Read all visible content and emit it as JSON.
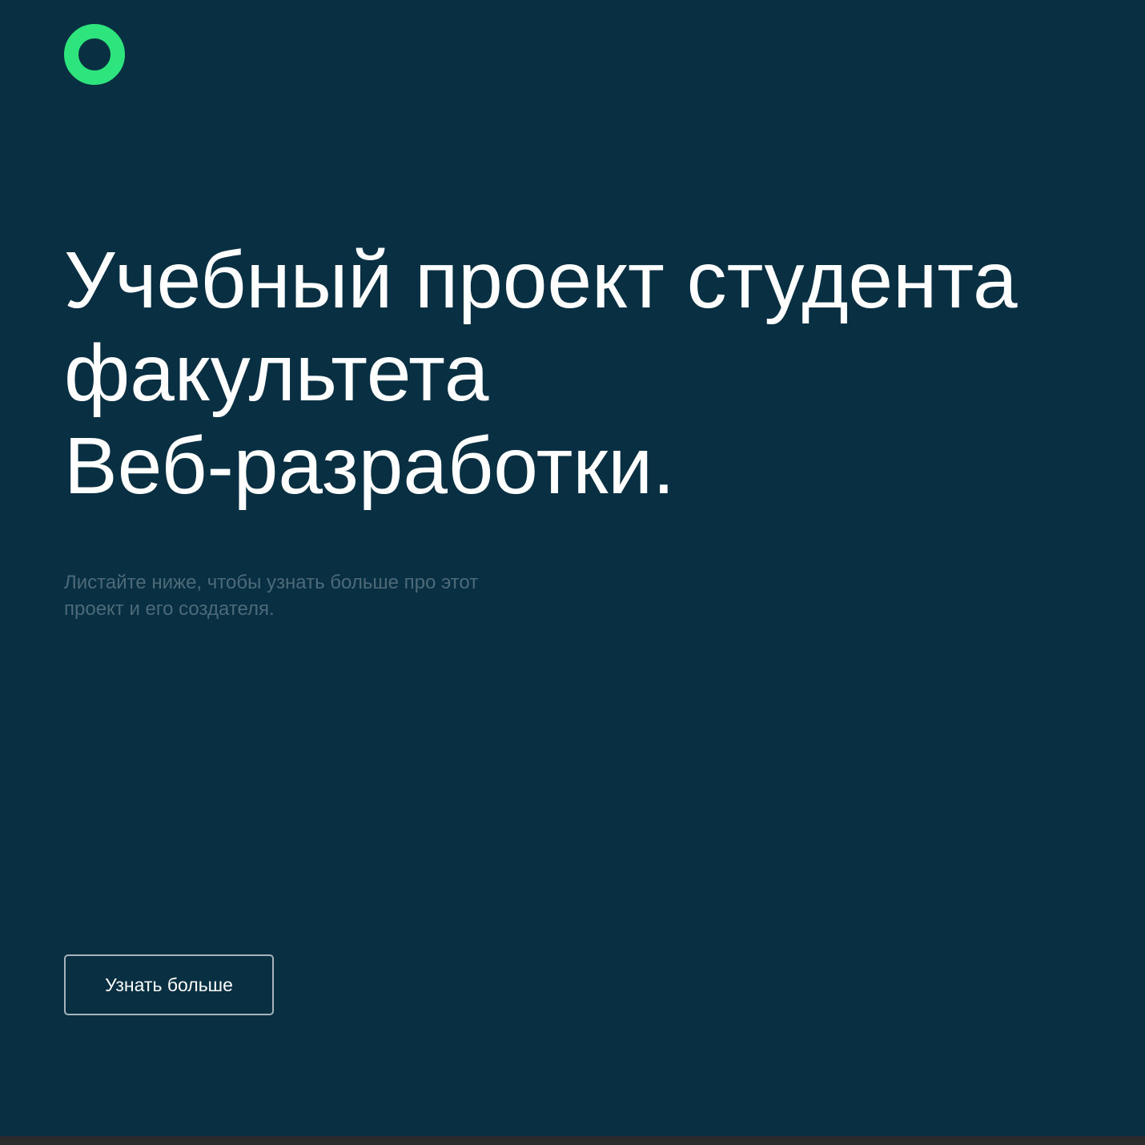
{
  "colors": {
    "background": "#082f42",
    "accent": "#2ee57d",
    "subtitle": "#4d6a79",
    "button_border": "#a7b4bb",
    "bottom_bar": "#2b2b2b"
  },
  "header": {
    "logo_icon": "ring-logo-icon"
  },
  "hero": {
    "title_lines": [
      "Учебный проект студента",
      "факультета",
      "Веб-разработки."
    ],
    "subtitle_lines": [
      "Листайте ниже, чтобы узнать больше про этот",
      "проект и его создателя."
    ],
    "button_label": "Узнать больше"
  }
}
